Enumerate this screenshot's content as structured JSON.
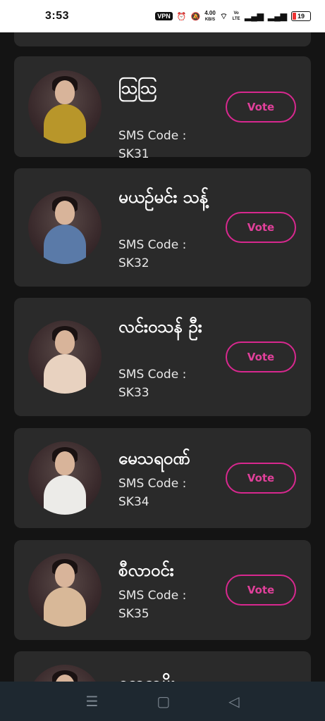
{
  "status_bar": {
    "time": "3:53",
    "vpn": "VPN",
    "speed_value": "4.00",
    "speed_unit": "KB/S",
    "volte": "Vo LTE",
    "battery": "19"
  },
  "contestants": [
    {
      "name": "ဩဩ",
      "sms_label": "SMS Code :",
      "sms_code": "SK31",
      "vote_label": "Vote",
      "dress_color": "#b8962a"
    },
    {
      "name": "မယဉ်မင်း သန့်",
      "sms_label": "SMS Code :",
      "sms_code": "SK32",
      "vote_label": "Vote",
      "dress_color": "#5a7aa8"
    },
    {
      "name": "လင်းဝသန် ဦး",
      "sms_label": "SMS Code :",
      "sms_code": "SK33",
      "vote_label": "Vote",
      "dress_color": "#e8d2c0"
    },
    {
      "name": "မေသရဝဏ်",
      "sms_label": "SMS Code :",
      "sms_code": "SK34",
      "vote_label": "Vote",
      "dress_color": "#ecebe8"
    },
    {
      "name": "စီလာဝင်း",
      "sms_label": "SMS Code :",
      "sms_code": "SK35",
      "vote_label": "Vote",
      "dress_color": "#d8b898"
    },
    {
      "name": "ကေဇာမိုး",
      "dress_color": "#c0a0a0"
    }
  ],
  "nav": {
    "recents_icon": "☰",
    "home_icon": "▢",
    "back_icon": "◁"
  },
  "colors": {
    "accent": "#d8288f",
    "card": "#2a2a2a",
    "background": "#141414"
  }
}
